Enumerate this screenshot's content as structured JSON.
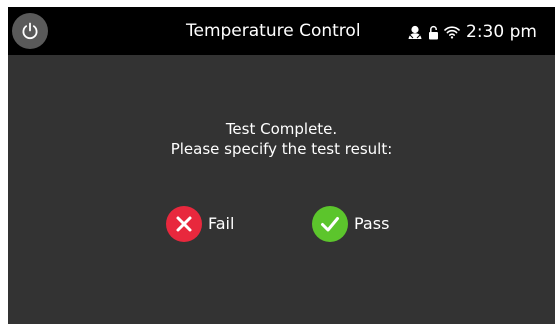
{
  "status_bar": {
    "title": "Temperature Control",
    "time": "2:30 pm",
    "icons": [
      "power-icon",
      "user-icon",
      "lock-icon",
      "wifi-icon"
    ]
  },
  "dialog": {
    "line1": "Test Complete.",
    "line2": "Please specify the test result:"
  },
  "buttons": {
    "fail_label": "Fail",
    "pass_label": "Pass"
  },
  "colors": {
    "background": "#333333",
    "status_bar": "#000000",
    "fail": "#e8283d",
    "pass": "#5cc52c"
  }
}
